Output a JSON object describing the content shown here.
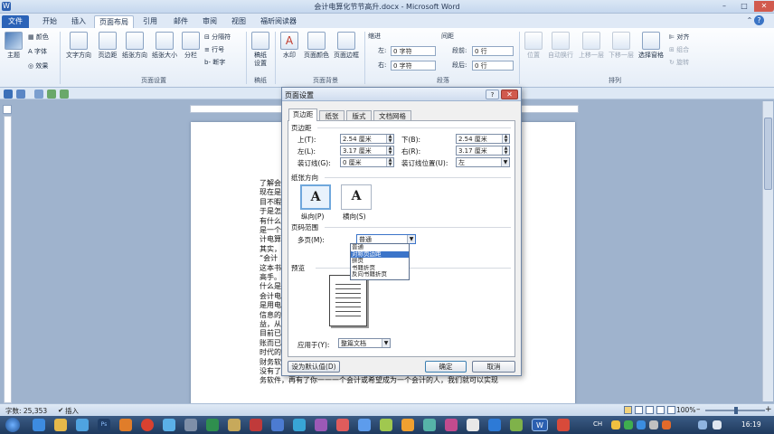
{
  "window": {
    "title": "会计电算化节节高升.docx - Microsoft Word",
    "app_icon": "W",
    "minimize": "–",
    "maximize": "□",
    "close": "✕"
  },
  "tabs": [
    "文件",
    "开始",
    "插入",
    "页面布局",
    "引用",
    "邮件",
    "审阅",
    "视图",
    "福昕阅读器"
  ],
  "ribbon": {
    "theme": {
      "themes": "主题",
      "colors": "颜色",
      "fonts": "字体",
      "effects": "效果"
    },
    "page_setup": {
      "text_direction": "文字方向",
      "margins": "页边距",
      "orientation": "纸张方向",
      "size": "纸张大小",
      "columns": "分栏",
      "breaks": "分隔符",
      "line_numbers": "行号",
      "hyphenation": "断字",
      "group": "页面设置"
    },
    "manuscript": {
      "setup": "稿纸\n设置",
      "group": "稿纸"
    },
    "page_background": {
      "watermark": "水印",
      "page_color": "页面颜色",
      "page_borders": "页面边框",
      "group": "页面背景"
    },
    "paragraph": {
      "indent": "缩进",
      "spacing": "间距",
      "left": "左:",
      "right": "右:",
      "before": "段前:",
      "after": "段后:",
      "left_val": "0 字符",
      "right_val": "0 字符",
      "before_val": "0 行",
      "after_val": "0 行",
      "group": "段落"
    },
    "arrange": {
      "position": "位置",
      "wrap": "自动换行",
      "forward": "上移一层",
      "backward": "下移一层",
      "selection": "选择窗格",
      "align": "对齐",
      "group_btn": "组合",
      "rotate": "旋转",
      "group": "排列"
    }
  },
  "document": {
    "lines": [
      "了解会",
      "现在是",
      "目不暇",
      "于是怎",
      "有什么",
      "是一个",
      "计电算",
      "其实，",
      "“会计",
      "这本书",
      "高手。",
      "什么是",
      "会计电",
      "是用电",
      "信息的",
      "益，从",
      "目前已",
      "账而已",
      "时代的",
      "财务软件就是实现会计电算化的最重要的工具之一，当然就此之外还需要人。",
      "没有了人的操作，财务软件也不会自动工作。所以，只要有了一款合适的财",
      "务软件，再有了你一一一个会计或希望成为一个会计的人，我们就可以实现"
    ]
  },
  "dialog": {
    "title": "页面设置",
    "help": "?",
    "close": "✕",
    "tabs": [
      "页边距",
      "纸张",
      "版式",
      "文档网格"
    ],
    "margins_section": "页边距",
    "top_label": "上(T):",
    "top_value": "2.54 厘米",
    "bottom_label": "下(B):",
    "bottom_value": "2.54 厘米",
    "left_label": "左(L):",
    "left_value": "3.17 厘米",
    "right_label": "右(R):",
    "right_value": "3.17 厘米",
    "gutter_label": "装订线(G):",
    "gutter_value": "0 厘米",
    "gutter_pos_label": "装订线位置(U):",
    "gutter_pos_value": "左",
    "orientation_section": "纸张方向",
    "portrait": "纵向(P)",
    "landscape": "横向(S)",
    "pages_section": "页码范围",
    "multiple_pages_label": "多页(M):",
    "multiple_pages_value": "普通",
    "dropdown_options": [
      "普通",
      "对称页边距",
      "拼页",
      "书籍折页",
      "反向书籍折页"
    ],
    "preview_section": "预览",
    "apply_to_label": "应用于(Y):",
    "apply_to_value": "整篇文档",
    "set_default": "设为默认值(D)",
    "ok": "确定",
    "cancel": "取消"
  },
  "status": {
    "words": "字数: 25,353",
    "language": "插入",
    "zoom": "100%",
    "zoom_minus": "–",
    "zoom_plus": "+"
  },
  "taskbar": {
    "language": "CH",
    "time": "16:19"
  }
}
